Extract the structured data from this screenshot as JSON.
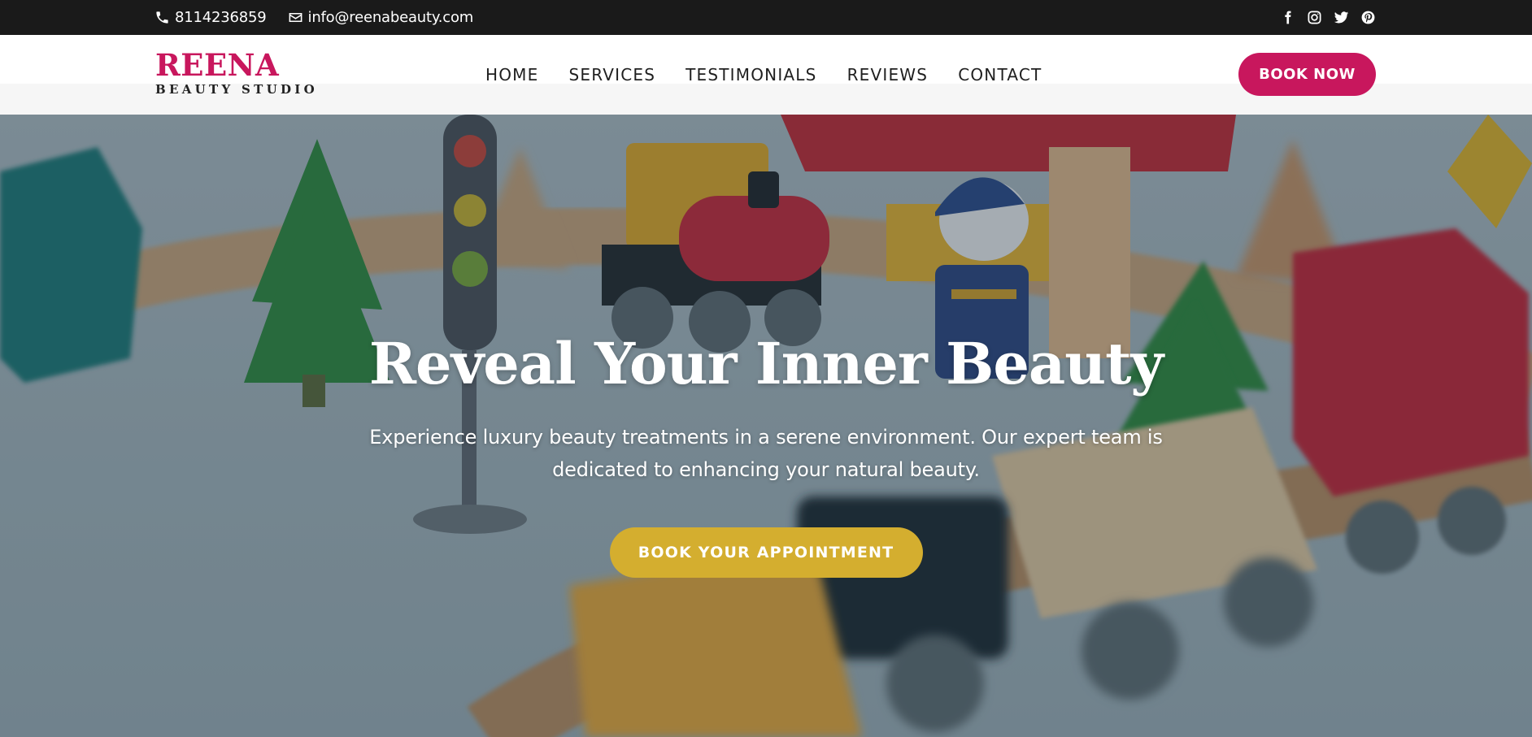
{
  "topbar": {
    "phone": "8114236859",
    "email": "info@reenabeauty.com",
    "phone_icon": "phone-icon",
    "email_icon": "envelope-icon",
    "social": [
      "facebook-icon",
      "instagram-icon",
      "twitter-icon",
      "pinterest-icon"
    ]
  },
  "brand": {
    "name": "REENA",
    "tagline": "BEAUTY STUDIO"
  },
  "nav": {
    "items": [
      "HOME",
      "SERVICES",
      "TESTIMONIALS",
      "REVIEWS",
      "CONTACT"
    ],
    "book_now": "BOOK NOW"
  },
  "hero": {
    "title": "Reveal Your Inner Beauty",
    "subtitle": "Experience luxury beauty treatments in a serene environment. Our expert team is dedicated to enhancing your natural beauty.",
    "cta": "BOOK YOUR APPOINTMENT",
    "background": "toy-train-photo"
  },
  "colors": {
    "topbar_bg": "#1a1a1a",
    "brand": "#c8175d",
    "cta_gold": "#d4ae2f",
    "nav_text": "#1f1f1f"
  }
}
